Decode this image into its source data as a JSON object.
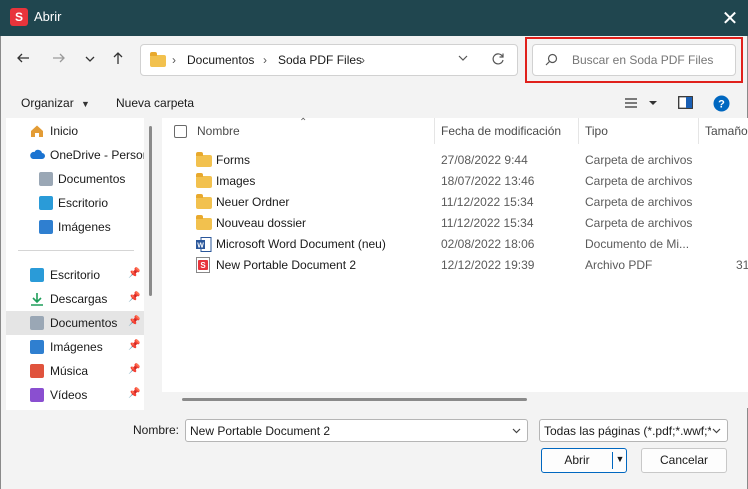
{
  "window": {
    "app_icon_letter": "S",
    "title": "Abrir",
    "close_glyph": "✕",
    "accent_color": "#20464f"
  },
  "address_bar": {
    "crumbs": [
      "Documentos",
      "Soda PDF Files"
    ],
    "separator": "›"
  },
  "search": {
    "placeholder": "Buscar en Soda PDF Files",
    "highlight_color": "#e0201b"
  },
  "toolbar": {
    "organize_label": "Organizar",
    "new_folder_label": "Nueva carpeta"
  },
  "nav_pane": {
    "items": [
      {
        "label": "Inicio",
        "icon": "home-icon"
      },
      {
        "label": "OneDrive - Person",
        "icon": "cloud-icon"
      },
      {
        "label": "Documentos",
        "icon": "document-icon"
      },
      {
        "label": "Escritorio",
        "icon": "desktop-icon"
      },
      {
        "label": "Imágenes",
        "icon": "image-icon"
      },
      {
        "label": "Escritorio",
        "icon": "desktop-icon"
      },
      {
        "label": "Descargas",
        "icon": "download-icon"
      },
      {
        "label": "Documentos",
        "icon": "document-icon"
      },
      {
        "label": "Imágenes",
        "icon": "image-icon"
      },
      {
        "label": "Música",
        "icon": "music-icon"
      },
      {
        "label": "Vídeos",
        "icon": "video-icon"
      }
    ]
  },
  "file_list": {
    "columns": [
      "Nombre",
      "Fecha de modificación",
      "Tipo",
      "Tamaño"
    ],
    "rows": [
      {
        "name": "Forms",
        "date": "27/08/2022 9:44",
        "type": "Carpeta de archivos",
        "size": "",
        "icon": "folder-icon"
      },
      {
        "name": "Images",
        "date": "18/07/2022 13:46",
        "type": "Carpeta de archivos",
        "size": "",
        "icon": "folder-icon"
      },
      {
        "name": "Neuer Ordner",
        "date": "11/12/2022 15:34",
        "type": "Carpeta de archivos",
        "size": "",
        "icon": "folder-icon"
      },
      {
        "name": "Nouveau dossier",
        "date": "11/12/2022 15:34",
        "type": "Carpeta de archivos",
        "size": "",
        "icon": "folder-icon"
      },
      {
        "name": "Microsoft Word Document (neu)",
        "date": "02/08/2022 18:06",
        "type": "Documento de Mi...",
        "size": "",
        "icon": "word-icon"
      },
      {
        "name": "New Portable Document 2",
        "date": "12/12/2022 19:39",
        "type": "Archivo PDF",
        "size": "31",
        "icon": "pdf-icon"
      }
    ]
  },
  "footer": {
    "name_label": "Nombre:",
    "name_value": "New Portable Document 2",
    "type_filter": "Todas las páginas (*.pdf;*.wwf;*",
    "open_label": "Abrir",
    "cancel_label": "Cancelar"
  }
}
